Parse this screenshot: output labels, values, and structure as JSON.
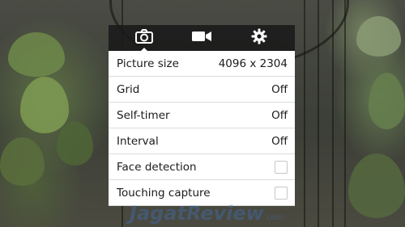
{
  "tabs": [
    {
      "icon": "camera-icon",
      "active": true
    },
    {
      "icon": "video-camera-icon",
      "active": false
    },
    {
      "icon": "gear-icon",
      "active": false
    }
  ],
  "settings": [
    {
      "label": "Picture size",
      "value": "4096 x 2304",
      "type": "value"
    },
    {
      "label": "Grid",
      "value": "Off",
      "type": "value"
    },
    {
      "label": "Self-timer",
      "value": "Off",
      "type": "value"
    },
    {
      "label": "Interval",
      "value": "Off",
      "type": "value"
    },
    {
      "label": "Face detection",
      "checked": false,
      "type": "checkbox"
    },
    {
      "label": "Touching capture",
      "checked": false,
      "type": "checkbox"
    }
  ],
  "watermark": {
    "text": "JagatReview",
    "suffix": ".com"
  },
  "colors": {
    "panel_bg": "#ffffff",
    "tabbar_bg": "#191919",
    "text": "#1b1b1b"
  }
}
